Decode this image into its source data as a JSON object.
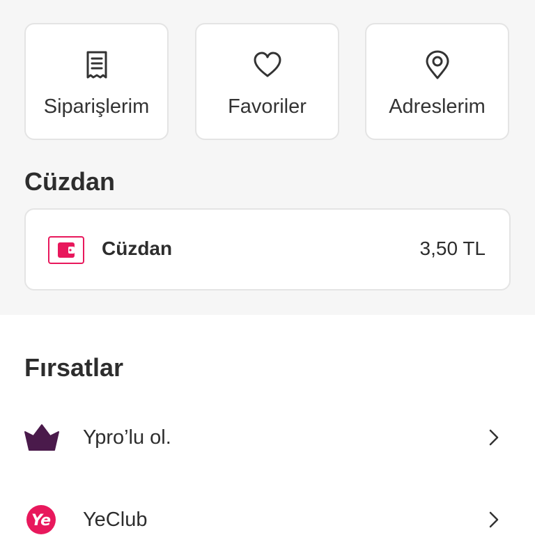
{
  "quick_links": [
    {
      "label": "Siparişlerim",
      "icon": "receipt-icon"
    },
    {
      "label": "Favoriler",
      "icon": "heart-icon"
    },
    {
      "label": "Adreslerim",
      "icon": "location-pin-icon"
    }
  ],
  "wallet_section": {
    "title": "Cüzdan",
    "card_label": "Cüzdan",
    "balance": "3,50 TL",
    "icon": "wallet-icon"
  },
  "offers_section": {
    "title": "Fırsatlar",
    "items": [
      {
        "label": "Ypro’lu ol.",
        "icon": "crown-icon"
      },
      {
        "label": "YeClub",
        "icon": "yeclub-logo-icon"
      }
    ]
  },
  "colors": {
    "brand_pink": "#e8185c",
    "crown_purple": "#4a1a4b",
    "background_gray": "#f6f6f6",
    "card_border": "#e4e4e4"
  }
}
